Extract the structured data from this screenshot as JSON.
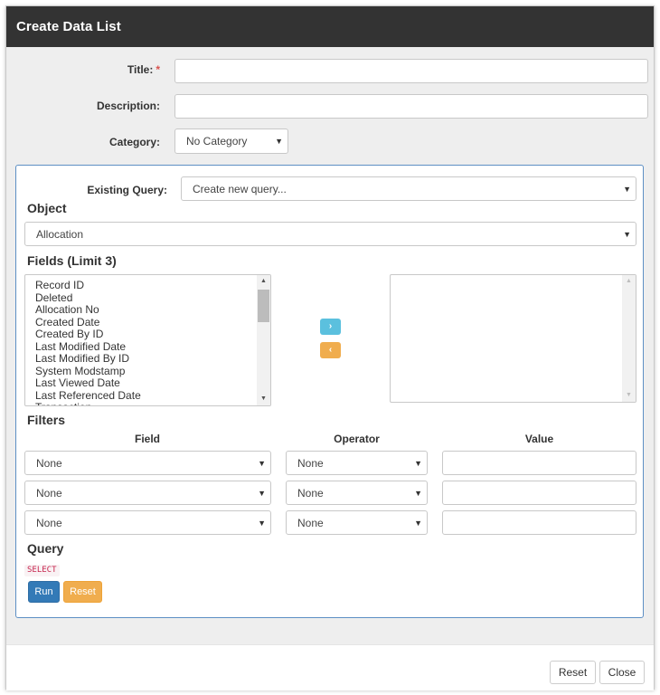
{
  "modal": {
    "title": "Create Data List"
  },
  "form": {
    "title_label": "Title:",
    "required_mark": "*",
    "title_value": "",
    "description_label": "Description:",
    "description_value": "",
    "category_label": "Category:",
    "category_selected": "No Category"
  },
  "query_builder": {
    "existing_query_label": "Existing Query:",
    "existing_query_selected": "Create new query...",
    "object_heading": "Object",
    "object_selected": "Allocation",
    "fields_heading": "Fields (Limit 3)",
    "available_fields": [
      "Record ID",
      "Deleted",
      "Allocation No",
      "Created Date",
      "Created By ID",
      "Last Modified Date",
      "Last Modified By ID",
      "System Modstamp",
      "Last Viewed Date",
      "Last Referenced Date",
      "Transaction"
    ],
    "selected_fields": [],
    "move_right_symbol": "›",
    "move_left_symbol": "‹",
    "filters_heading": "Filters",
    "filter_columns": {
      "field": "Field",
      "operator": "Operator",
      "value": "Value"
    },
    "filters": [
      {
        "field": "None",
        "operator": "None",
        "value": ""
      },
      {
        "field": "None",
        "operator": "None",
        "value": ""
      },
      {
        "field": "None",
        "operator": "None",
        "value": ""
      }
    ],
    "query_heading": "Query",
    "query_text": "SELECT",
    "run_label": "Run",
    "reset_label": "Reset"
  },
  "footer": {
    "reset_label": "Reset",
    "close_label": "Close"
  },
  "colors": {
    "header_bg": "#333333",
    "panel_border": "#5d8fc4",
    "move_right": "#5bc0de",
    "move_left": "#f0ad4e",
    "primary": "#337ab7",
    "warning": "#f0ad4e",
    "required": "#d9534f"
  },
  "icons": {
    "dropdown": "caret-down-icon",
    "move_right": "chevron-right-icon",
    "move_left": "chevron-left-icon"
  }
}
